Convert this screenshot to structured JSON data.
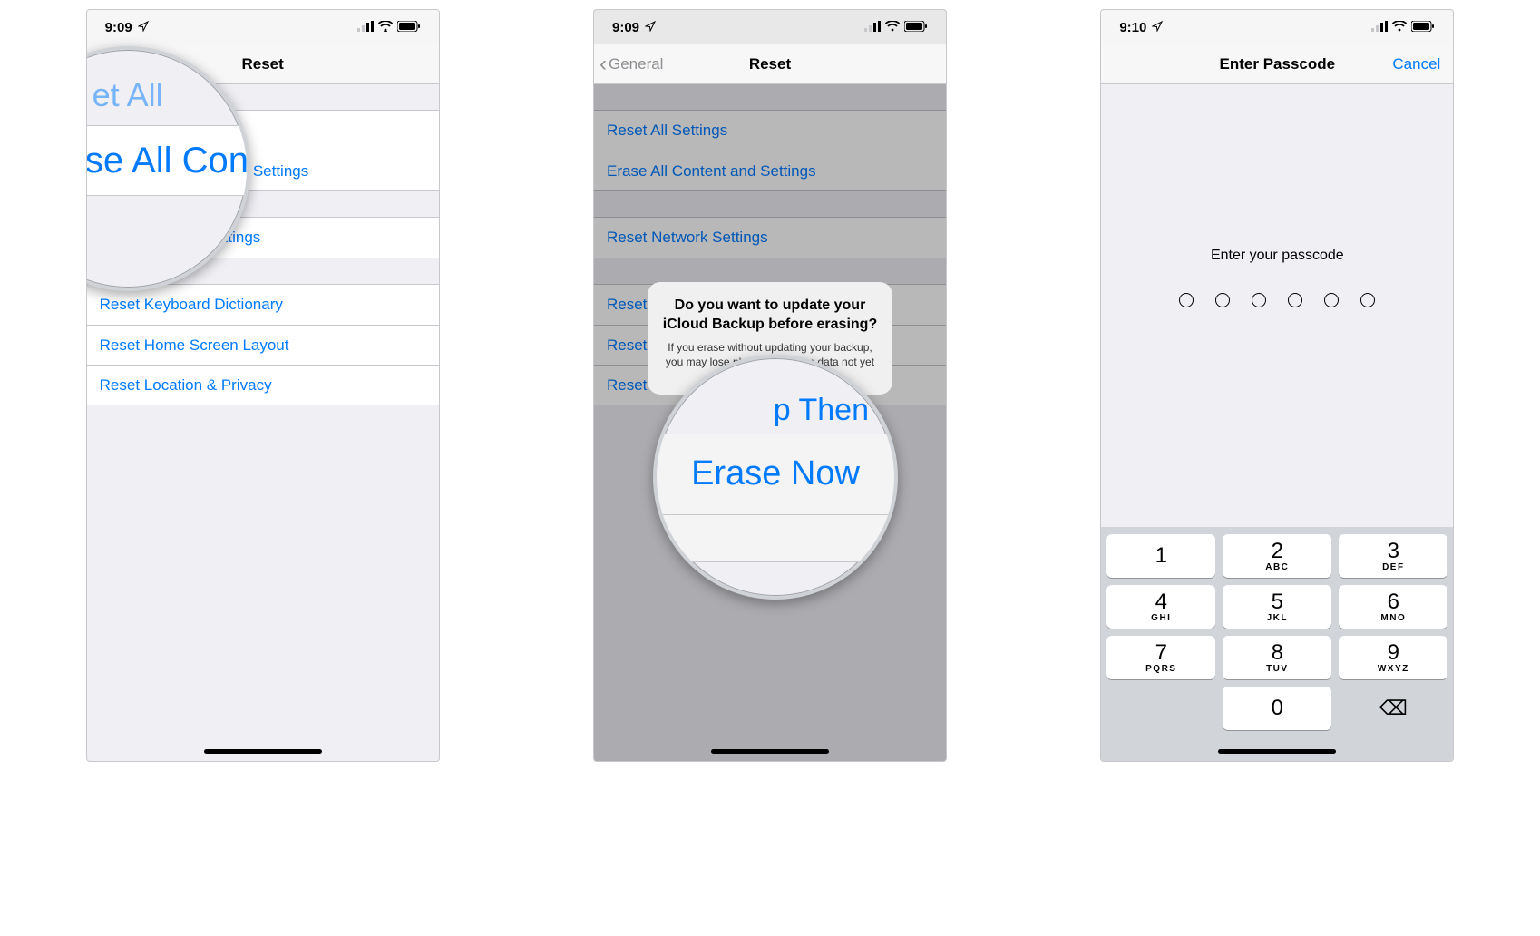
{
  "screen1": {
    "status_time": "9:09",
    "nav_title": "Reset",
    "rows_group1": [
      "Reset All Settings",
      "Erase All Content and Settings"
    ],
    "rows_group2": [
      "Reset Network Settings"
    ],
    "rows_group3": [
      "Reset Keyboard Dictionary",
      "Reset Home Screen Layout",
      "Reset Location & Privacy"
    ],
    "magnifier_top_fragment": "et All",
    "magnifier_main": "Erase All Con"
  },
  "screen2": {
    "status_time": "9:09",
    "nav_back": "General",
    "nav_title": "Reset",
    "rows_group1": [
      "Reset All Settings",
      "Erase All Content and Settings"
    ],
    "rows_group2": [
      "Reset Network Settings"
    ],
    "rows_group3": [
      "Reset Keyboard Dictionary",
      "Reset Home Screen Layout",
      "Reset Location & Privacy"
    ],
    "alert_title": "Do you want to update your iCloud Backup before erasing?",
    "alert_msg": "If you erase without updating your backup, you may lose photos and other data not yet uploaded to iCloud.",
    "magnifier_fragment": "p Then",
    "magnifier_main": "Erase Now"
  },
  "screen3": {
    "status_time": "9:10",
    "nav_title": "Enter Passcode",
    "nav_cancel": "Cancel",
    "prompt": "Enter your passcode",
    "passcode_length": 6,
    "keypad": [
      {
        "num": "1",
        "letters": ""
      },
      {
        "num": "2",
        "letters": "ABC"
      },
      {
        "num": "3",
        "letters": "DEF"
      },
      {
        "num": "4",
        "letters": "GHI"
      },
      {
        "num": "5",
        "letters": "JKL"
      },
      {
        "num": "6",
        "letters": "MNO"
      },
      {
        "num": "7",
        "letters": "PQRS"
      },
      {
        "num": "8",
        "letters": "TUV"
      },
      {
        "num": "9",
        "letters": "WXYZ"
      },
      {
        "num": "",
        "letters": "",
        "empty": true
      },
      {
        "num": "0",
        "letters": ""
      },
      {
        "num": "⌫",
        "letters": "",
        "backspace": true
      }
    ]
  }
}
